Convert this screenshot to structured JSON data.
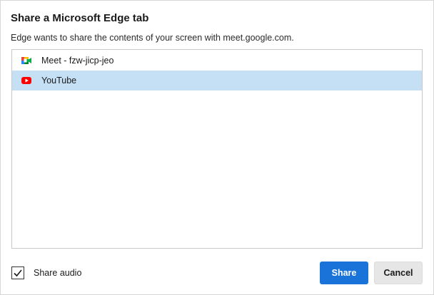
{
  "dialog": {
    "title": "Share a Microsoft Edge tab",
    "subtitle": "Edge wants to share the contents of your screen with meet.google.com."
  },
  "tabs": [
    {
      "label": "Meet - fzw-jicp-jeo",
      "icon": "google-meet-icon",
      "selected": false
    },
    {
      "label": "YouTube",
      "icon": "youtube-icon",
      "selected": true
    }
  ],
  "audio": {
    "label": "Share audio",
    "checked": true
  },
  "buttons": {
    "share_label": "Share",
    "cancel_label": "Cancel"
  },
  "colors": {
    "selected_row": "#c5dff5",
    "primary_button": "#1a73d9",
    "secondary_button": "#e6e6e6",
    "youtube_red": "#ff0000"
  }
}
